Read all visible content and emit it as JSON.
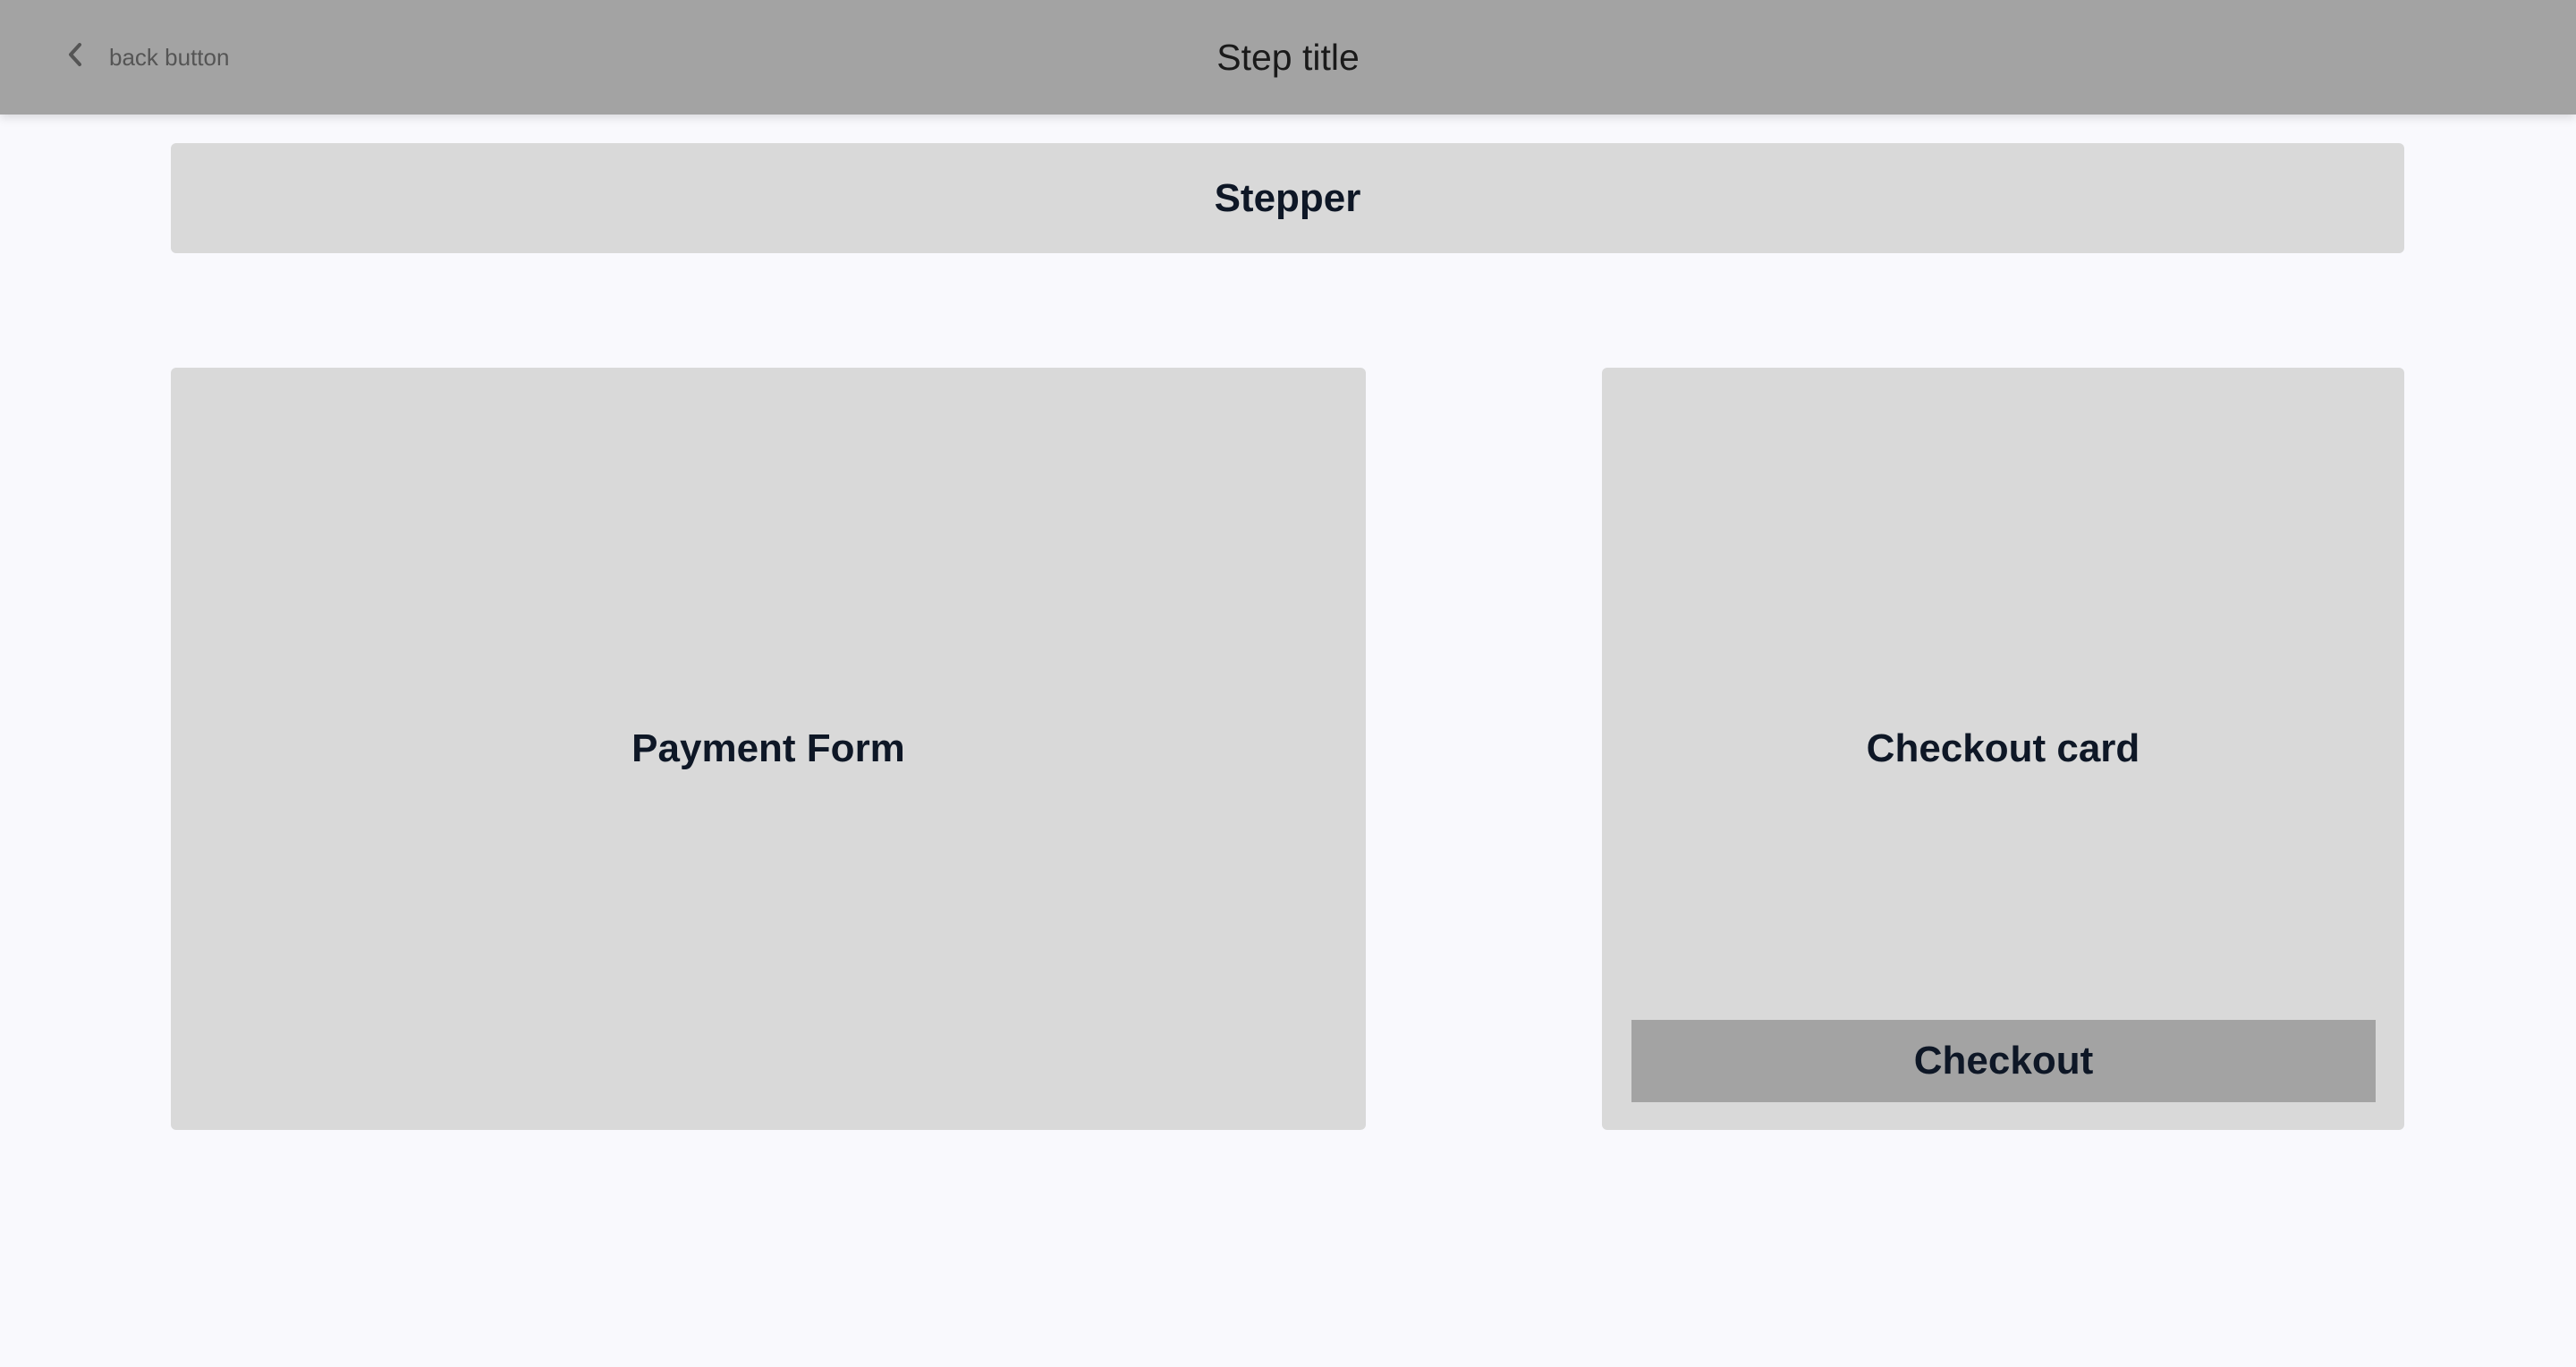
{
  "header": {
    "back_label": "back button",
    "back_icon": "chevron-left-icon",
    "title": "Step title"
  },
  "stepper": {
    "label": "Stepper"
  },
  "payment_form": {
    "label": "Payment Form"
  },
  "checkout_card": {
    "label": "Checkout card",
    "button_label": "Checkout"
  }
}
